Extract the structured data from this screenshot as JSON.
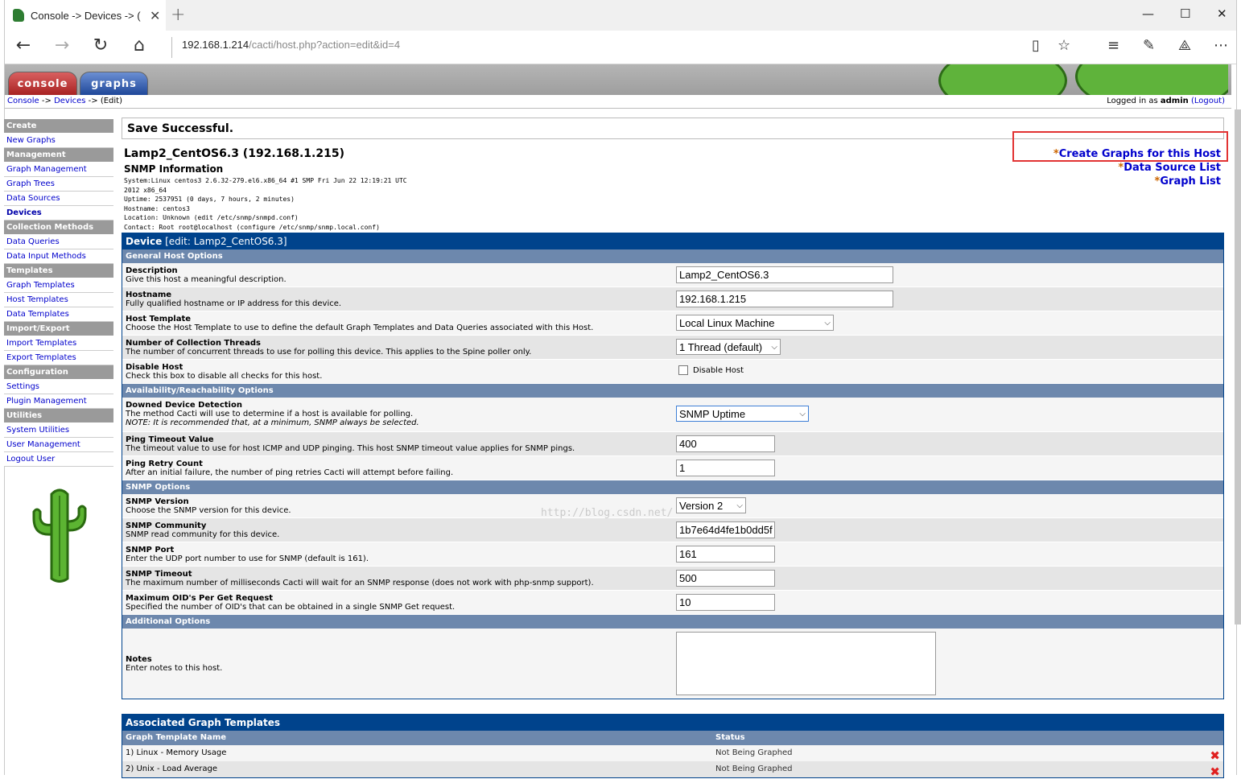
{
  "browser": {
    "tab_title": "Console -> Devices -> (",
    "close": "✕",
    "new_tab": "+",
    "url_host": "192.168.1.214",
    "url_path": "/cacti/host.php?action=edit&id=4",
    "minimize": "—",
    "maximize": "☐",
    "close_window": "✕"
  },
  "header": {
    "console_tab": "console",
    "graphs_tab": "graphs",
    "breadcrumb": {
      "console": "Console",
      "sep1": " -> ",
      "devices": "Devices",
      "sep2": " -> (Edit)"
    },
    "login_prefix": "Logged in as ",
    "user": "admin",
    "logout": "(Logout)"
  },
  "sidebar": {
    "create": "Create",
    "new_graphs": "New Graphs",
    "management": "Management",
    "graph_management": "Graph Management",
    "graph_trees": "Graph Trees",
    "data_sources": "Data Sources",
    "devices": "Devices",
    "collection_methods": "Collection Methods",
    "data_queries": "Data Queries",
    "data_input_methods": "Data Input Methods",
    "templates": "Templates",
    "graph_templates": "Graph Templates",
    "host_templates": "Host Templates",
    "data_templates": "Data Templates",
    "import_export": "Import/Export",
    "import_templates": "Import Templates",
    "export_templates": "Export Templates",
    "configuration": "Configuration",
    "settings": "Settings",
    "plugin_management": "Plugin Management",
    "utilities": "Utilities",
    "system_utilities": "System Utilities",
    "user_management": "User Management",
    "logout_user": "Logout User"
  },
  "main": {
    "save_message": "Save Successful.",
    "host_title": "Lamp2_CentOS6.3 (192.168.1.215)",
    "snmp_heading": "SNMP Information",
    "snmp_info": "System:Linux centos3 2.6.32-279.el6.x86_64 #1 SMP Fri Jun 22 12:19:21 UTC\n2012 x86_64\nUptime: 2537951 (0 days, 7 hours, 2 minutes)\nHostname: centos3\nLocation: Unknown (edit /etc/snmp/snmpd.conf)\nContact: Root root@localhost (configure /etc/snmp/snmp.local.conf)",
    "star": "*",
    "create_graphs_link": "Create Graphs for this Host",
    "data_source_list_link": "Data Source List",
    "graph_list_link": "Graph List",
    "watermark": "http://blog.csdn.net/"
  },
  "form": {
    "title": "Device",
    "title_suffix": " [edit: Lamp2_CentOS6.3]",
    "sec_general": "General Host Options",
    "description_label": "Description",
    "description_help": "Give this host a meaningful description.",
    "description_value": "Lamp2_CentOS6.3",
    "hostname_label": "Hostname",
    "hostname_help": "Fully qualified hostname or IP address for this device.",
    "hostname_value": "192.168.1.215",
    "host_template_label": "Host Template",
    "host_template_help": "Choose the Host Template to use to define the default Graph Templates and Data Queries associated with this Host.",
    "host_template_value": "Local Linux Machine",
    "threads_label": "Number of Collection Threads",
    "threads_help": "The number of concurrent threads to use for polling this device. This applies to the Spine poller only.",
    "threads_value": "1 Thread (default)",
    "disable_label": "Disable Host",
    "disable_help": "Check this box to disable all checks for this host.",
    "disable_checkbox_label": "Disable Host",
    "sec_avail": "Availability/Reachability Options",
    "downed_label": "Downed Device Detection",
    "downed_help": "The method Cacti will use to determine if a host is available for polling.",
    "downed_note": "NOTE: It is recommended that, at a minimum, SNMP always be selected.",
    "downed_value": "SNMP Uptime",
    "ping_timeout_label": "Ping Timeout Value",
    "ping_timeout_help": "The timeout value to use for host ICMP and UDP pinging. This host SNMP timeout value applies for SNMP pings.",
    "ping_timeout_value": "400",
    "ping_retry_label": "Ping Retry Count",
    "ping_retry_help": "After an initial failure, the number of ping retries Cacti will attempt before failing.",
    "ping_retry_value": "1",
    "sec_snmp": "SNMP Options",
    "snmp_version_label": "SNMP Version",
    "snmp_version_help": "Choose the SNMP version for this device.",
    "snmp_version_value": "Version 2",
    "snmp_community_label": "SNMP Community",
    "snmp_community_help": "SNMP read community for this device.",
    "snmp_community_value": "1b7e64d4fe1b0dd5f",
    "snmp_port_label": "SNMP Port",
    "snmp_port_help": "Enter the UDP port number to use for SNMP (default is 161).",
    "snmp_port_value": "161",
    "snmp_timeout_label": "SNMP Timeout",
    "snmp_timeout_help": "The maximum number of milliseconds Cacti will wait for an SNMP response (does not work with php-snmp support).",
    "snmp_timeout_value": "500",
    "max_oids_label": "Maximum OID's Per Get Request",
    "max_oids_help": "Specified the number of OID's that can be obtained in a single SNMP Get request.",
    "max_oids_value": "10",
    "sec_additional": "Additional Options",
    "notes_label": "Notes",
    "notes_help": "Enter notes to this host.",
    "notes_value": ""
  },
  "assoc": {
    "title": "Associated Graph Templates",
    "col_name": "Graph Template Name",
    "col_status": "Status",
    "rows": [
      {
        "name": "1) Linux - Memory Usage",
        "status": "Not Being Graphed"
      },
      {
        "name": "2) Unix - Load Average",
        "status": "Not Being Graphed"
      }
    ],
    "delete_glyph": "✖"
  }
}
